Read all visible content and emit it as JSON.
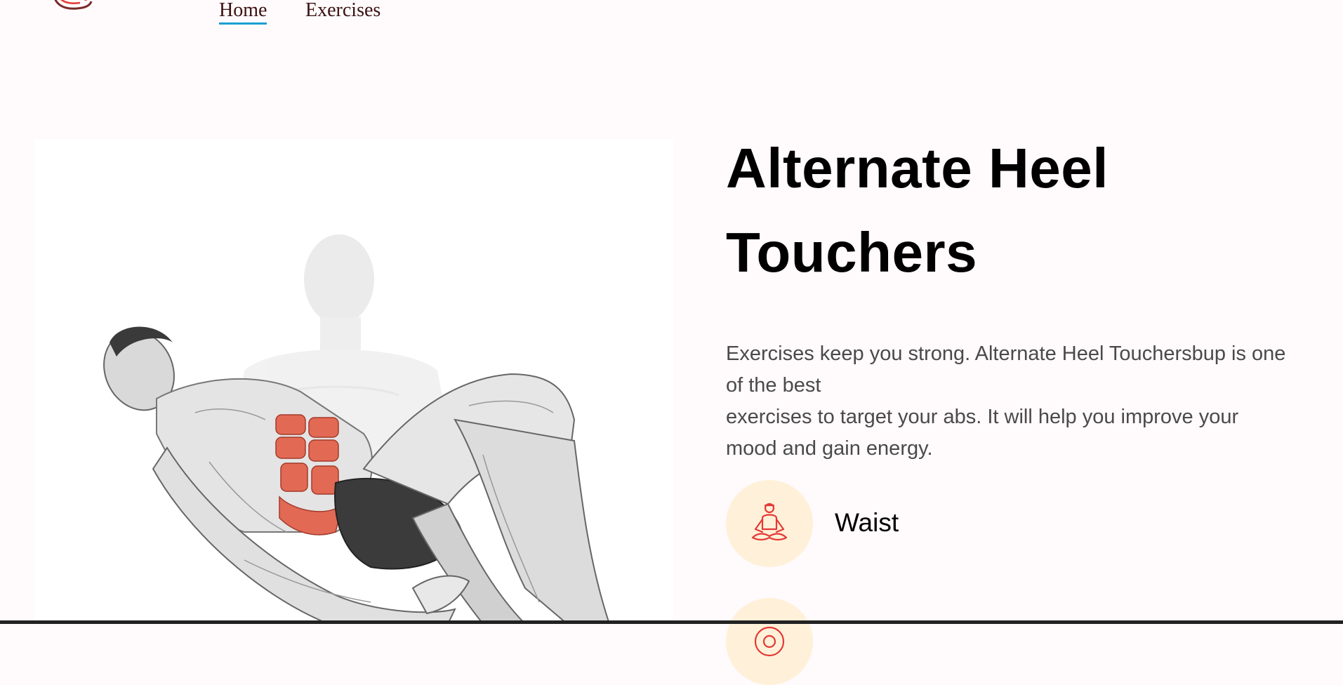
{
  "nav": {
    "logo_icon": "gym-logo-icon",
    "links": [
      {
        "label": "Home",
        "active": true
      },
      {
        "label": "Exercises",
        "active": false
      }
    ]
  },
  "exercise": {
    "image_icon": "exercise-illustration",
    "title_line1": "Alternate Heel",
    "title_line2": "Touchers",
    "description_line1": "Exercises keep you strong. Alternate Heel Touchersbup is one of the best",
    "description_line2": "exercises to target your abs. It will help you improve your mood and gain energy.",
    "badges": [
      {
        "icon": "meditation-icon",
        "label": "Waist"
      },
      {
        "icon": "target-icon",
        "label": ""
      }
    ]
  },
  "colors": {
    "accent": "#1b9fd3",
    "badge_bg": "#fff1d9",
    "icon_red": "#e53935",
    "page_bg": "#fffafb"
  }
}
